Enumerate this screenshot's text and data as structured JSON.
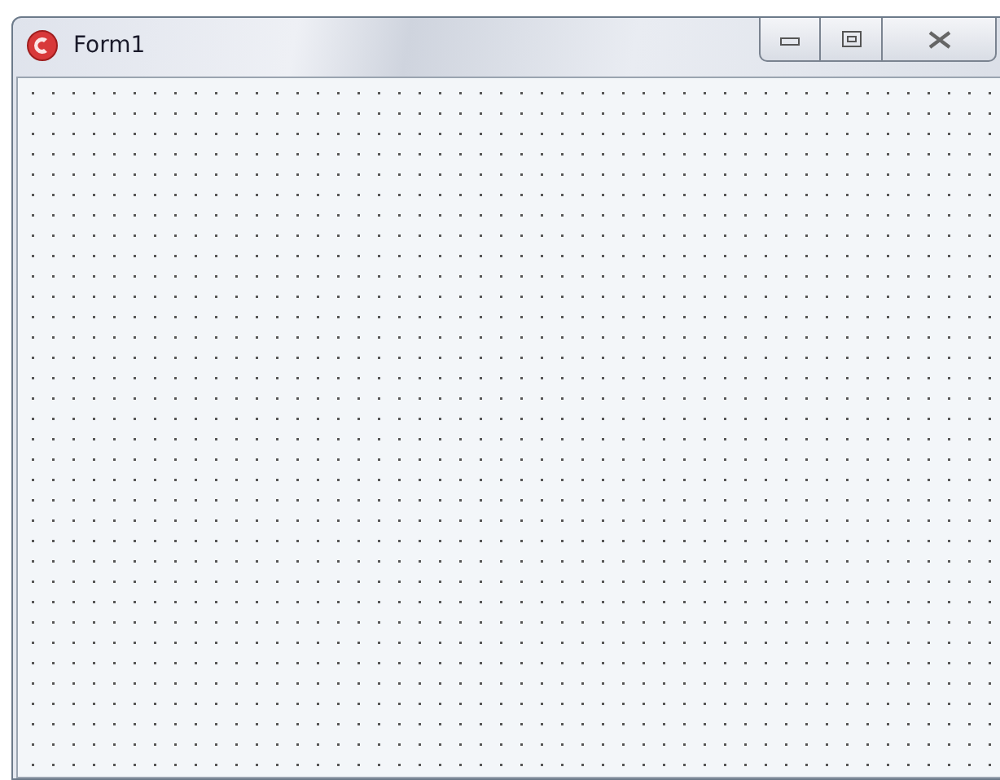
{
  "window": {
    "title": "Form1"
  }
}
